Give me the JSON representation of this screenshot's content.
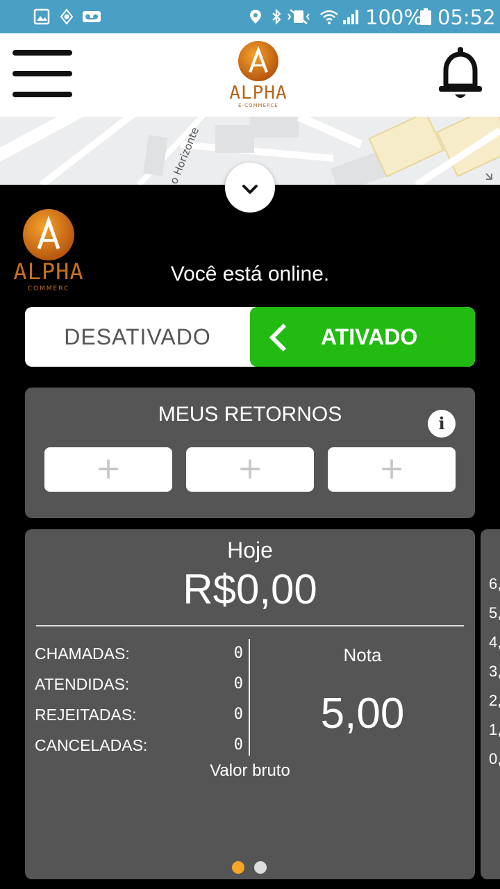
{
  "status_bar": {
    "battery_text": "100%",
    "time": "05:52"
  },
  "header": {
    "logo_text": "ALPHA",
    "logo_sub": "E-COMMERCE"
  },
  "map": {
    "street_label": "o Horizonte"
  },
  "panel": {
    "logo_text": "ALPHA",
    "logo_sub": "COMMERC",
    "online_message": "Você está online."
  },
  "toggle": {
    "off_label": "DESATIVADO",
    "on_label": "ATIVADO",
    "active_color": "#22bb11"
  },
  "returns": {
    "title": "MEUS RETORNOS",
    "info_glyph": "i",
    "slots": [
      "+",
      "+",
      "+"
    ]
  },
  "today": {
    "title": "Hoje",
    "amount": "R$0,00",
    "stats": [
      {
        "label": "CHAMADAS:",
        "value": "0"
      },
      {
        "label": "ATENDIDAS:",
        "value": "0"
      },
      {
        "label": "REJEITADAS:",
        "value": "0"
      },
      {
        "label": "CANCELADAS:",
        "value": "0"
      }
    ],
    "rating_label": "Nota",
    "rating_value": "5,00",
    "gross_label": "Valor bruto",
    "pager": {
      "active_color": "#f5a623",
      "inactive_color": "#dddddd",
      "pages": 2,
      "current": 1
    }
  },
  "next_card": {
    "axis_labels": [
      "6,",
      "5,",
      "4,",
      "3,",
      "2,",
      "1,",
      "0,"
    ]
  }
}
